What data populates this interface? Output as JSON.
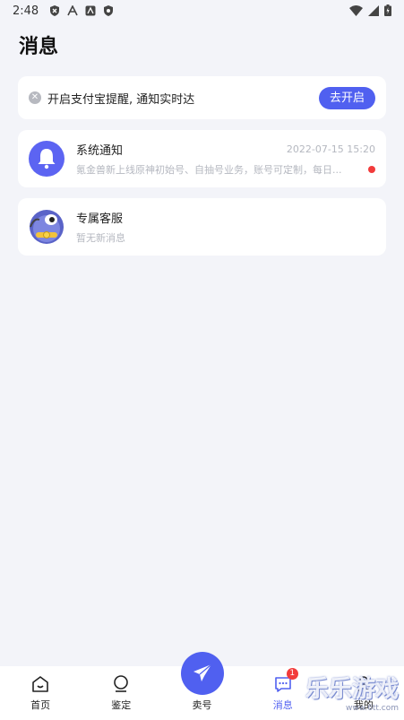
{
  "status_bar": {
    "time": "2:48"
  },
  "header": {
    "title": "消息"
  },
  "notice": {
    "text": "开启支付宝提醒, 通知实时达",
    "button_label": "去开启"
  },
  "messages": [
    {
      "name": "系统通知",
      "time": "2022-07-15 15:20",
      "preview": "氪金兽新上线原神初始号、自抽号业务，账号可定制，每日...",
      "unread": true,
      "avatar_icon": "bell-icon"
    },
    {
      "name": "专属客服",
      "time": "",
      "preview": "暂无新消息",
      "unread": false,
      "avatar_icon": "monster-avatar"
    }
  ],
  "tabbar": {
    "items": [
      {
        "label": "首页",
        "icon": "home-icon"
      },
      {
        "label": "鉴定",
        "icon": "appraise-icon"
      },
      {
        "label": "卖号",
        "icon": "send-icon"
      },
      {
        "label": "消息",
        "icon": "chat-icon",
        "badge": "1",
        "active": true
      },
      {
        "label": "我的",
        "icon": "user-icon"
      }
    ]
  },
  "watermark": {
    "text": "乐乐游戏",
    "site": "www.6tt.com"
  },
  "colors": {
    "accent": "#5060f0",
    "background": "#f3f4f9",
    "unread": "#f23b3b"
  }
}
